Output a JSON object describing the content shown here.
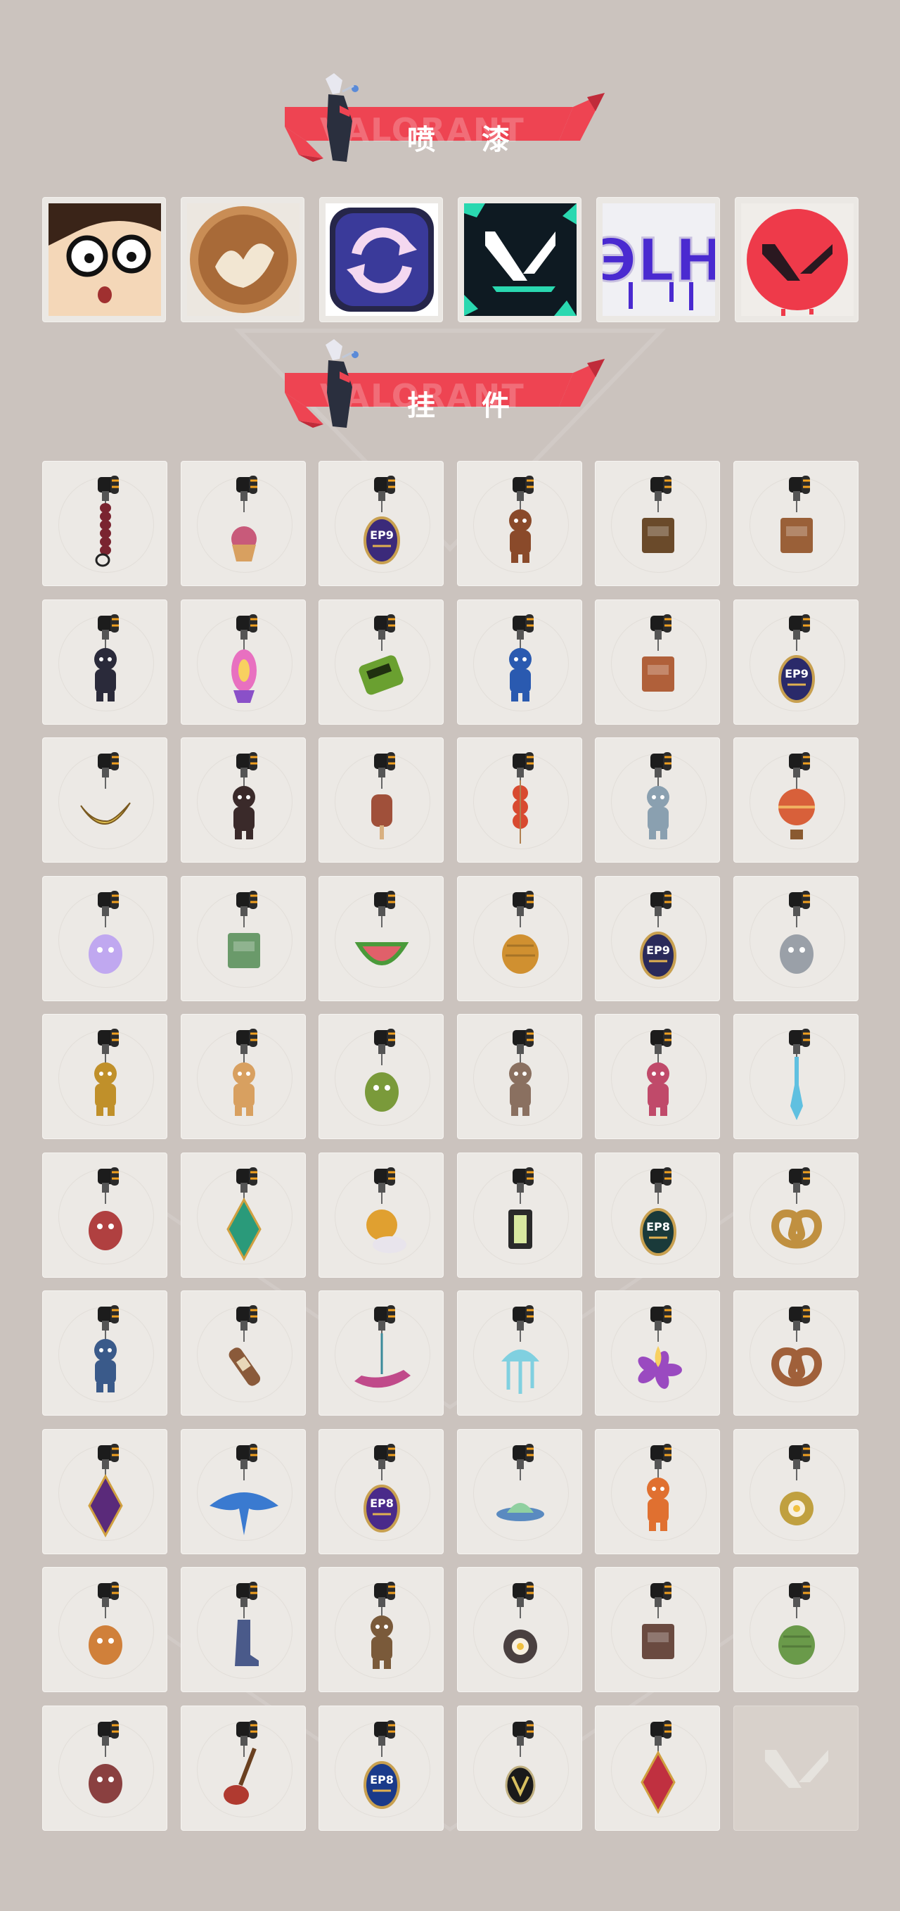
{
  "sections": {
    "sprays": {
      "title": "喷 漆",
      "ghost": "VALORANT"
    },
    "charms": {
      "title": "挂 件",
      "ghost": "VALORANT"
    }
  },
  "colors": {
    "background": "#cbc3be",
    "banner_red": "#ee4452",
    "banner_dark": "#c02b3a",
    "tile": "#ece9e5"
  },
  "sprays": [
    {
      "name": "cartoon-face-glasses",
      "kind": "face"
    },
    {
      "name": "latte-art",
      "kind": "latte"
    },
    {
      "name": "swap-arrows",
      "kind": "arrows"
    },
    {
      "name": "valorant-logo-teal",
      "kind": "vlogo"
    },
    {
      "name": "purple-graffiti",
      "kind": "graffiti",
      "text": "ЭLH"
    },
    {
      "name": "red-valorant-drip",
      "kind": "redlogo"
    }
  ],
  "charms": [
    {
      "name": "braided-rope",
      "color": "#7a2430",
      "shape": "rope"
    },
    {
      "name": "cupcake",
      "color": "#c85a7a",
      "shape": "cupcake"
    },
    {
      "name": "ep9-act-medal-purple",
      "color": "#3b2a7a",
      "shape": "medal",
      "text": "EP9"
    },
    {
      "name": "bear-with-bell",
      "color": "#8a4a2a",
      "shape": "figure"
    },
    {
      "name": "lunchbox-gadget",
      "color": "#6a4a2a",
      "shape": "box"
    },
    {
      "name": "cardboard-box",
      "color": "#9a6038",
      "shape": "box"
    },
    {
      "name": "robot-doll",
      "color": "#2a2a3a",
      "shape": "figure"
    },
    {
      "name": "lava-lamp",
      "color": "#8a50c8",
      "shape": "lamp"
    },
    {
      "name": "green-pager",
      "color": "#6aa030",
      "shape": "pager"
    },
    {
      "name": "astronaut",
      "color": "#2a5ab0",
      "shape": "figure"
    },
    {
      "name": "radio-device",
      "color": "#b0603a",
      "shape": "box"
    },
    {
      "name": "ep9-act-medal-red",
      "color": "#2a2a6a",
      "shape": "medal",
      "text": "EP9"
    },
    {
      "name": "banana-slice",
      "color": "#e0c050",
      "shape": "crescent"
    },
    {
      "name": "dark-feather-doll",
      "color": "#3a2a2a",
      "shape": "figure"
    },
    {
      "name": "popsicle",
      "color": "#a0503a",
      "shape": "popsicle"
    },
    {
      "name": "tanghulu-skewer",
      "color": "#d84a30",
      "shape": "skewer"
    },
    {
      "name": "chibi-agent-sticker",
      "color": "#8aa0b0",
      "shape": "figure"
    },
    {
      "name": "hot-air-balloon",
      "color": "#d8603a",
      "shape": "balloon"
    },
    {
      "name": "ghost-blob",
      "color": "#c0a8f0",
      "shape": "blob"
    },
    {
      "name": "bot-figure",
      "color": "#6a9a6a",
      "shape": "box"
    },
    {
      "name": "watermelon-slice",
      "color": "#e0606a",
      "shape": "melon"
    },
    {
      "name": "honey-pot",
      "color": "#d09030",
      "shape": "pot"
    },
    {
      "name": "ep9-act-medal-gold",
      "color": "#2a2a5a",
      "shape": "medal",
      "text": "EP9"
    },
    {
      "name": "silver-fish",
      "color": "#9aa0a8",
      "shape": "blob"
    },
    {
      "name": "golden-robot",
      "color": "#c0902a",
      "shape": "figure"
    },
    {
      "name": "corgi-dog",
      "color": "#d8a060",
      "shape": "figure"
    },
    {
      "name": "green-mask",
      "color": "#7a9a3a",
      "shape": "blob"
    },
    {
      "name": "raccoon",
      "color": "#8a7060",
      "shape": "figure"
    },
    {
      "name": "mech-hero",
      "color": "#c04a6a",
      "shape": "figure"
    },
    {
      "name": "ice-blade",
      "color": "#60c0e0",
      "shape": "blade"
    },
    {
      "name": "red-octopus",
      "color": "#b04040",
      "shape": "blob"
    },
    {
      "name": "green-crystal",
      "color": "#2a9a7a",
      "shape": "diamond"
    },
    {
      "name": "sun-cloud",
      "color": "#e0a030",
      "shape": "sun"
    },
    {
      "name": "lantern",
      "color": "#5a7a3a",
      "shape": "lantern"
    },
    {
      "name": "ep8-act-medal-green",
      "color": "#1a3a3a",
      "shape": "medal",
      "text": "EP8"
    },
    {
      "name": "pretzel-gold",
      "color": "#c09040",
      "shape": "pretzel"
    },
    {
      "name": "penguin-claw",
      "color": "#3a5a8a",
      "shape": "figure"
    },
    {
      "name": "bottle",
      "color": "#8a5a3a",
      "shape": "bottle"
    },
    {
      "name": "jetski",
      "color": "#c04a8a",
      "shape": "boat"
    },
    {
      "name": "jellyfish",
      "color": "#80d0e0",
      "shape": "jelly"
    },
    {
      "name": "purple-flower-flame",
      "color": "#9a4ac0",
      "shape": "flower"
    },
    {
      "name": "pretzel-brown",
      "color": "#a0603a",
      "shape": "pretzel"
    },
    {
      "name": "dark-eye-gem",
      "color": "#5a2a7a",
      "shape": "diamond"
    },
    {
      "name": "manta-ray",
      "color": "#3a7ad0",
      "shape": "manta"
    },
    {
      "name": "ep8-act-medal-purple",
      "color": "#4a2a8a",
      "shape": "medal",
      "text": "EP8"
    },
    {
      "name": "ufo",
      "color": "#5a8ac0",
      "shape": "ufo"
    },
    {
      "name": "tiger-cub",
      "color": "#e07030",
      "shape": "figure"
    },
    {
      "name": "frying-pan-egg",
      "color": "#c0a040",
      "shape": "pan"
    },
    {
      "name": "mushroom-car",
      "color": "#d0803a",
      "shape": "blob"
    },
    {
      "name": "blue-boot",
      "color": "#4a5a8a",
      "shape": "boot"
    },
    {
      "name": "bear-cub",
      "color": "#7a5a3a",
      "shape": "figure"
    },
    {
      "name": "pan-with-food",
      "color": "#4a4040",
      "shape": "pan"
    },
    {
      "name": "target-box",
      "color": "#6a4a40",
      "shape": "box"
    },
    {
      "name": "succulent-pot",
      "color": "#6a9a4a",
      "shape": "pot"
    },
    {
      "name": "cat-in-pod",
      "color": "#8a4040",
      "shape": "blob"
    },
    {
      "name": "electric-guitar",
      "color": "#b03a30",
      "shape": "guitar"
    },
    {
      "name": "ep8-act-medal-blue",
      "color": "#1a3a8a",
      "shape": "medal",
      "text": "EP8"
    },
    {
      "name": "valorant-v-coin",
      "color": "#1a1a1a",
      "shape": "vcoin"
    },
    {
      "name": "red-diamond-tag",
      "color": "#c03040",
      "shape": "diamond"
    },
    {
      "name": "empty-slot",
      "color": "#d8d1cb",
      "shape": "empty"
    }
  ]
}
